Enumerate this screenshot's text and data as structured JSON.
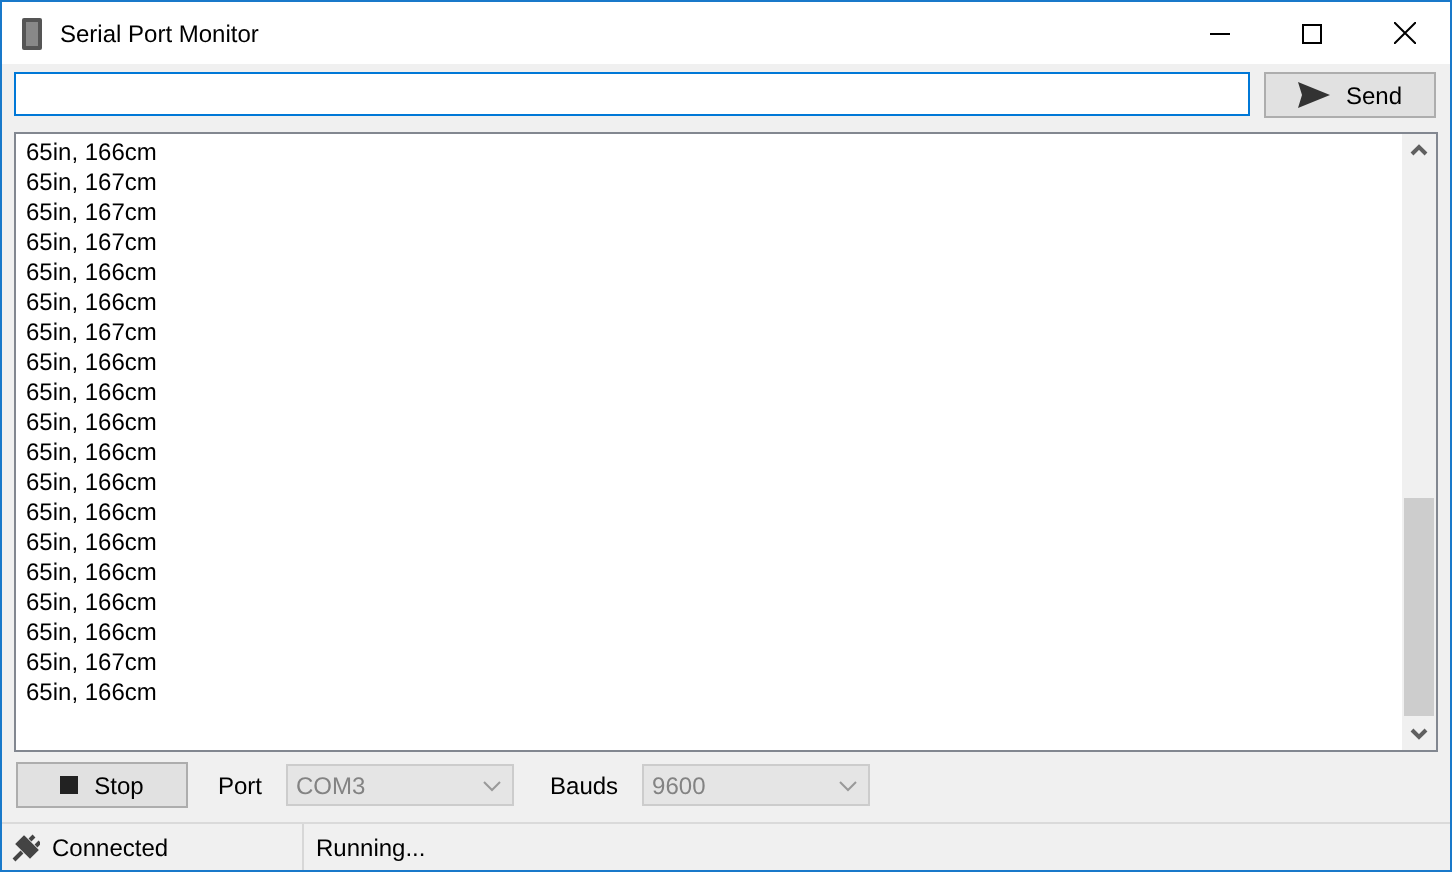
{
  "window": {
    "title": "Serial Port Monitor"
  },
  "send_button": {
    "label": "Send"
  },
  "log": [
    "65in, 166cm",
    "65in, 167cm",
    "65in, 167cm",
    "65in, 167cm",
    "65in, 166cm",
    "65in, 166cm",
    "65in, 167cm",
    "65in, 166cm",
    "65in, 166cm",
    "65in, 166cm",
    "65in, 166cm",
    "65in, 166cm",
    "65in, 166cm",
    "65in, 166cm",
    "65in, 166cm",
    "65in, 166cm",
    "65in, 166cm",
    "65in, 167cm",
    "65in, 166cm"
  ],
  "controls": {
    "stop_button": {
      "label": "Stop"
    },
    "port": {
      "label": "Port",
      "value": "COM3",
      "disabled": true
    },
    "bauds": {
      "label": "Bauds",
      "value": "9600",
      "disabled": true
    }
  },
  "status_bar": {
    "connection": "Connected",
    "status": "Running..."
  }
}
